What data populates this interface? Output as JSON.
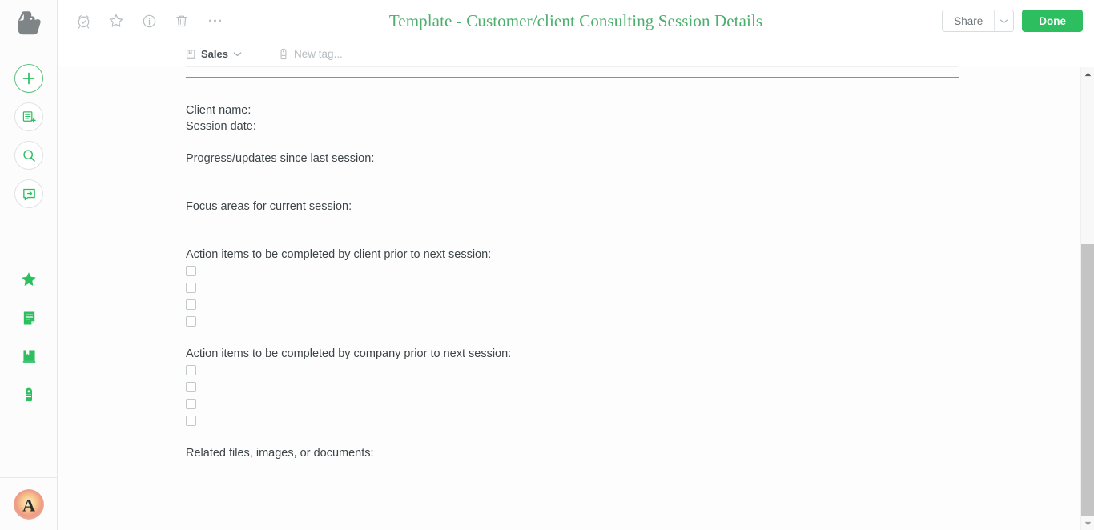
{
  "app": {
    "name": "Evernote",
    "logo_icon": "evernote-elephant-icon",
    "accent_color": "#2dbe60",
    "title_color": "#4caf6d"
  },
  "rail": {
    "quick_actions": [
      {
        "id": "new-note",
        "icon": "plus-icon",
        "label": "New Note"
      },
      {
        "id": "new-from-template",
        "icon": "note-plus-icon",
        "label": "New from Template"
      },
      {
        "id": "search",
        "icon": "search-icon",
        "label": "Search"
      },
      {
        "id": "share-note",
        "icon": "share-arrow-icon",
        "label": "Share"
      }
    ],
    "nav": [
      {
        "id": "shortcuts",
        "icon": "star-icon",
        "label": "Shortcuts"
      },
      {
        "id": "notes",
        "icon": "note-icon",
        "label": "Notes"
      },
      {
        "id": "notebooks",
        "icon": "notebook-icon",
        "label": "Notebooks"
      },
      {
        "id": "tags",
        "icon": "tag-icon",
        "label": "Tags"
      }
    ],
    "account": {
      "icon": "avatar",
      "initial": "A",
      "label": "Account"
    }
  },
  "topbar": {
    "icons": [
      {
        "id": "reminder",
        "icon": "alarm-clock-icon",
        "label": "Reminder"
      },
      {
        "id": "favorite",
        "icon": "star-outline-icon",
        "label": "Add to Shortcuts"
      },
      {
        "id": "info",
        "icon": "info-circle-icon",
        "label": "Note Info"
      },
      {
        "id": "delete",
        "icon": "trash-icon",
        "label": "Move to Trash"
      },
      {
        "id": "more",
        "icon": "ellipsis-icon",
        "label": "More"
      }
    ],
    "note_title": "Template - Customer/client Consulting Session Details",
    "share_label": "Share",
    "share_caret_icon": "chevron-down-icon",
    "done_label": "Done"
  },
  "metabar": {
    "notebook_icon": "notebook-icon",
    "notebook_name": "Sales",
    "notebook_caret_icon": "chevron-down-icon",
    "tag_icon": "tag-icon",
    "tag_placeholder": "New tag..."
  },
  "note": {
    "blocks": [
      {
        "type": "rule"
      },
      {
        "type": "text",
        "text": "Client name:"
      },
      {
        "type": "text",
        "text": "Session date:"
      },
      {
        "type": "spacer",
        "size": "sm"
      },
      {
        "type": "text",
        "text": "Progress/updates since last session:"
      },
      {
        "type": "spacer",
        "size": "md"
      },
      {
        "type": "text",
        "text": "Focus areas for current session:"
      },
      {
        "type": "spacer",
        "size": "md"
      },
      {
        "type": "text",
        "text": "Action items to be completed by client prior to next session:"
      },
      {
        "type": "checkbox",
        "checked": false,
        "text": ""
      },
      {
        "type": "checkbox",
        "checked": false,
        "text": ""
      },
      {
        "type": "checkbox",
        "checked": false,
        "text": ""
      },
      {
        "type": "checkbox",
        "checked": false,
        "text": ""
      },
      {
        "type": "spacer",
        "size": "sm"
      },
      {
        "type": "text",
        "text": "Action items to be completed by company prior to next session:"
      },
      {
        "type": "checkbox",
        "checked": false,
        "text": ""
      },
      {
        "type": "checkbox",
        "checked": false,
        "text": ""
      },
      {
        "type": "checkbox",
        "checked": false,
        "text": ""
      },
      {
        "type": "checkbox",
        "checked": false,
        "text": ""
      },
      {
        "type": "spacer",
        "size": "sm"
      },
      {
        "type": "text",
        "text": "Related files, images, or documents:"
      }
    ]
  },
  "scrollbar": {
    "up_icon": "triangle-up-icon",
    "down_icon": "triangle-down-icon",
    "thumb_position": "bottom"
  }
}
